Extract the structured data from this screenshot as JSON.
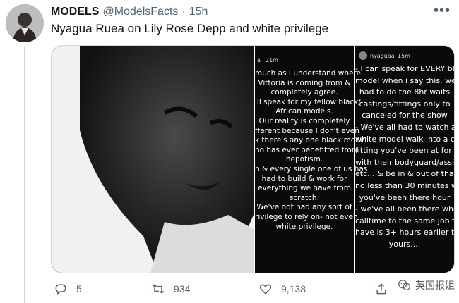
{
  "tweet": {
    "display_name": "MODELS",
    "handle": "@ModelsFacts",
    "separator": "·",
    "time": "15h",
    "text": "Nyagua Ruea on Lily Rose Depp and white privilege",
    "more_icon": "more-dots-icon"
  },
  "stories": {
    "middle": {
      "user": "a",
      "time": "21m",
      "text": "much as I understand where\nVittoria is coming from &\ncompletely agree.\nill speak for my fellow black/\nAfrican models.\nOur reality is completely\nfferent because I don't even\nk there's any one black model\nho has ever benefitted from\nnepotism.\nh & every single one of us has\nhad to build & work for\neverything we have from\nscratch.\nWe've not had any sort of\nrivilege to rely on- not even\nwhite privilege."
    },
    "right": {
      "user": "nyaguaa",
      "time": "15m",
      "text": "- I can speak for EVERY bl\nmodel when i say this, we'\nhad to do the 8hr waits\ncastings/fittings only to\ncanceled for the show\n- We've all had to watch a n\nwhite model walk into a cas\nfitting you've been at for H\nwith their bodyguard/assis\netc... & be in & out of that ro\nno less than 30 minutes w\nyou've been there hour\n- we've all been there whe\ncalltime to the same job t\nhave is 3+ hours earlier t\nyours...."
    }
  },
  "actions": {
    "reply_count": "5",
    "retweet_count": "934",
    "like_count": "9,138"
  },
  "watermark": {
    "text": "英国报姐"
  },
  "colors": {
    "text": "#0f1419",
    "secondary": "#536471",
    "border": "#cfd9de"
  }
}
